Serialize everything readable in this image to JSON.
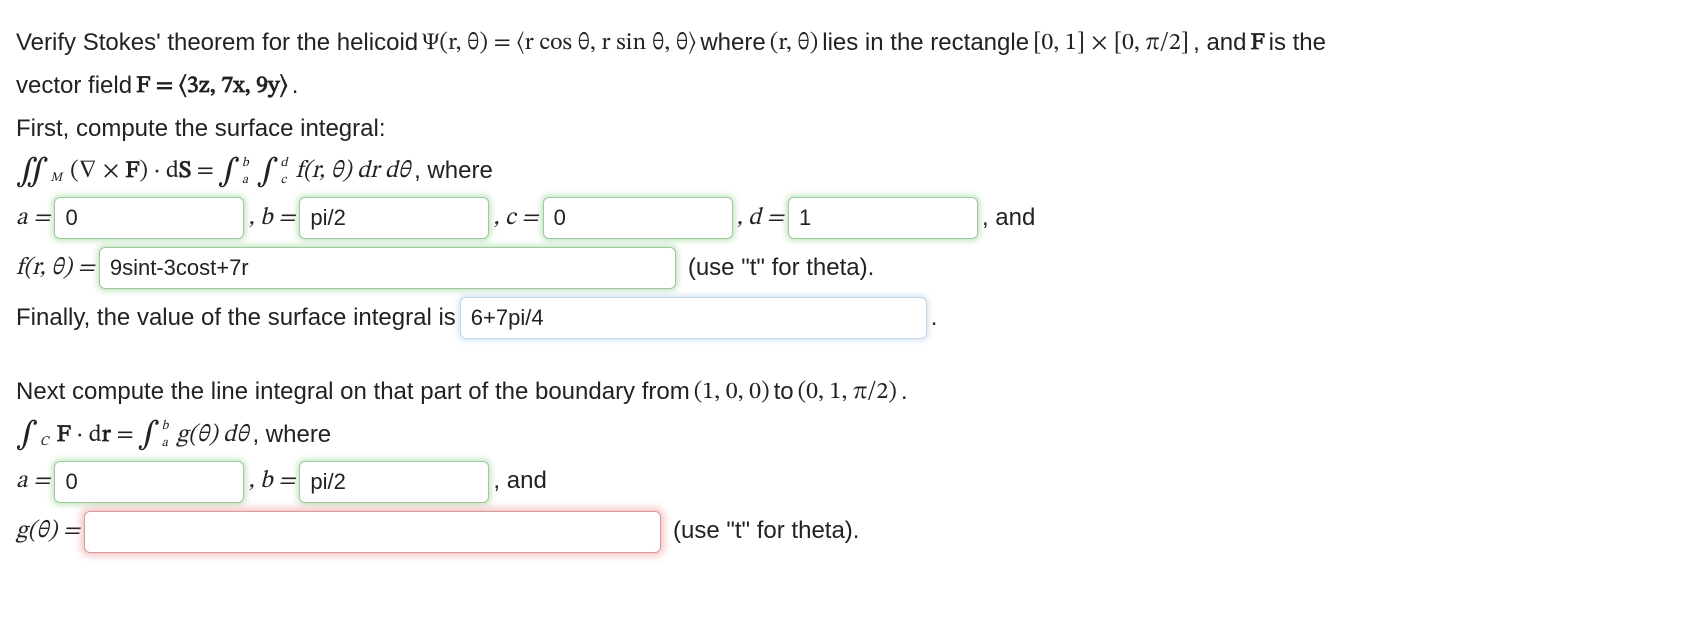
{
  "problem": {
    "intro_prefix": "Verify Stokes' theorem for the helicoid ",
    "psi_expr": "Ψ(r, θ) = ⟨r cos θ, r sin θ, θ⟩",
    "intro_mid": " where ",
    "rtheta": "(r, θ)",
    "intro_mid2": " lies in the rectangle ",
    "rect_expr": "[0, 1] × [0, π/2]",
    "intro_mid3": ", and ",
    "F_sym": "F",
    "intro_mid4": " is the",
    "intro_line2_prefix": "vector field ",
    "F_expr": "F = ⟨3z, 7x, 9y⟩",
    "intro_line2_suffix": "."
  },
  "surface": {
    "heading": "First, compute the surface integral:",
    "lhs_doubleint": "∬",
    "lhs_sub": "M",
    "lhs_expr": "(∇ × F) · dS = ",
    "rhs_int1_a": "a",
    "rhs_int1_b": "b",
    "rhs_int2_c": "c",
    "rhs_int2_d": "d",
    "rhs_integrand": "f(r, θ) dr dθ",
    "where": ", where",
    "labels": {
      "a": "a = ",
      "b": ", b = ",
      "c": ", c = ",
      "d": ", d = ",
      "and": ", and"
    },
    "values": {
      "a": "0",
      "b": "pi/2",
      "c": "0",
      "d": "1"
    },
    "f_label": "f(r, θ) = ",
    "f_value": "9sint-3cost+7r",
    "f_hint": "(use \"t\" for theta).",
    "final_label": "Finally, the value of the surface integral is ",
    "final_value": "6+7pi/4",
    "final_suffix": "."
  },
  "lineint": {
    "heading_prefix": "Next compute the line integral on that part of the boundary from ",
    "p1": "(1, 0, 0)",
    "heading_mid": " to ",
    "p2": "(0, 1, π/2)",
    "heading_suffix": ".",
    "lhs_int": "∫",
    "lhs_sub": "C",
    "lhs_expr": "F · dr = ",
    "rhs_a": "a",
    "rhs_b": "b",
    "rhs_integrand": "g(θ) dθ",
    "where": ", where",
    "labels": {
      "a": "a = ",
      "b": ", b = ",
      "and": ", and"
    },
    "values": {
      "a": "0",
      "b": "pi/2"
    },
    "g_label": "g(θ) = ",
    "g_value": "",
    "g_hint": "(use \"t\" for theta)."
  }
}
